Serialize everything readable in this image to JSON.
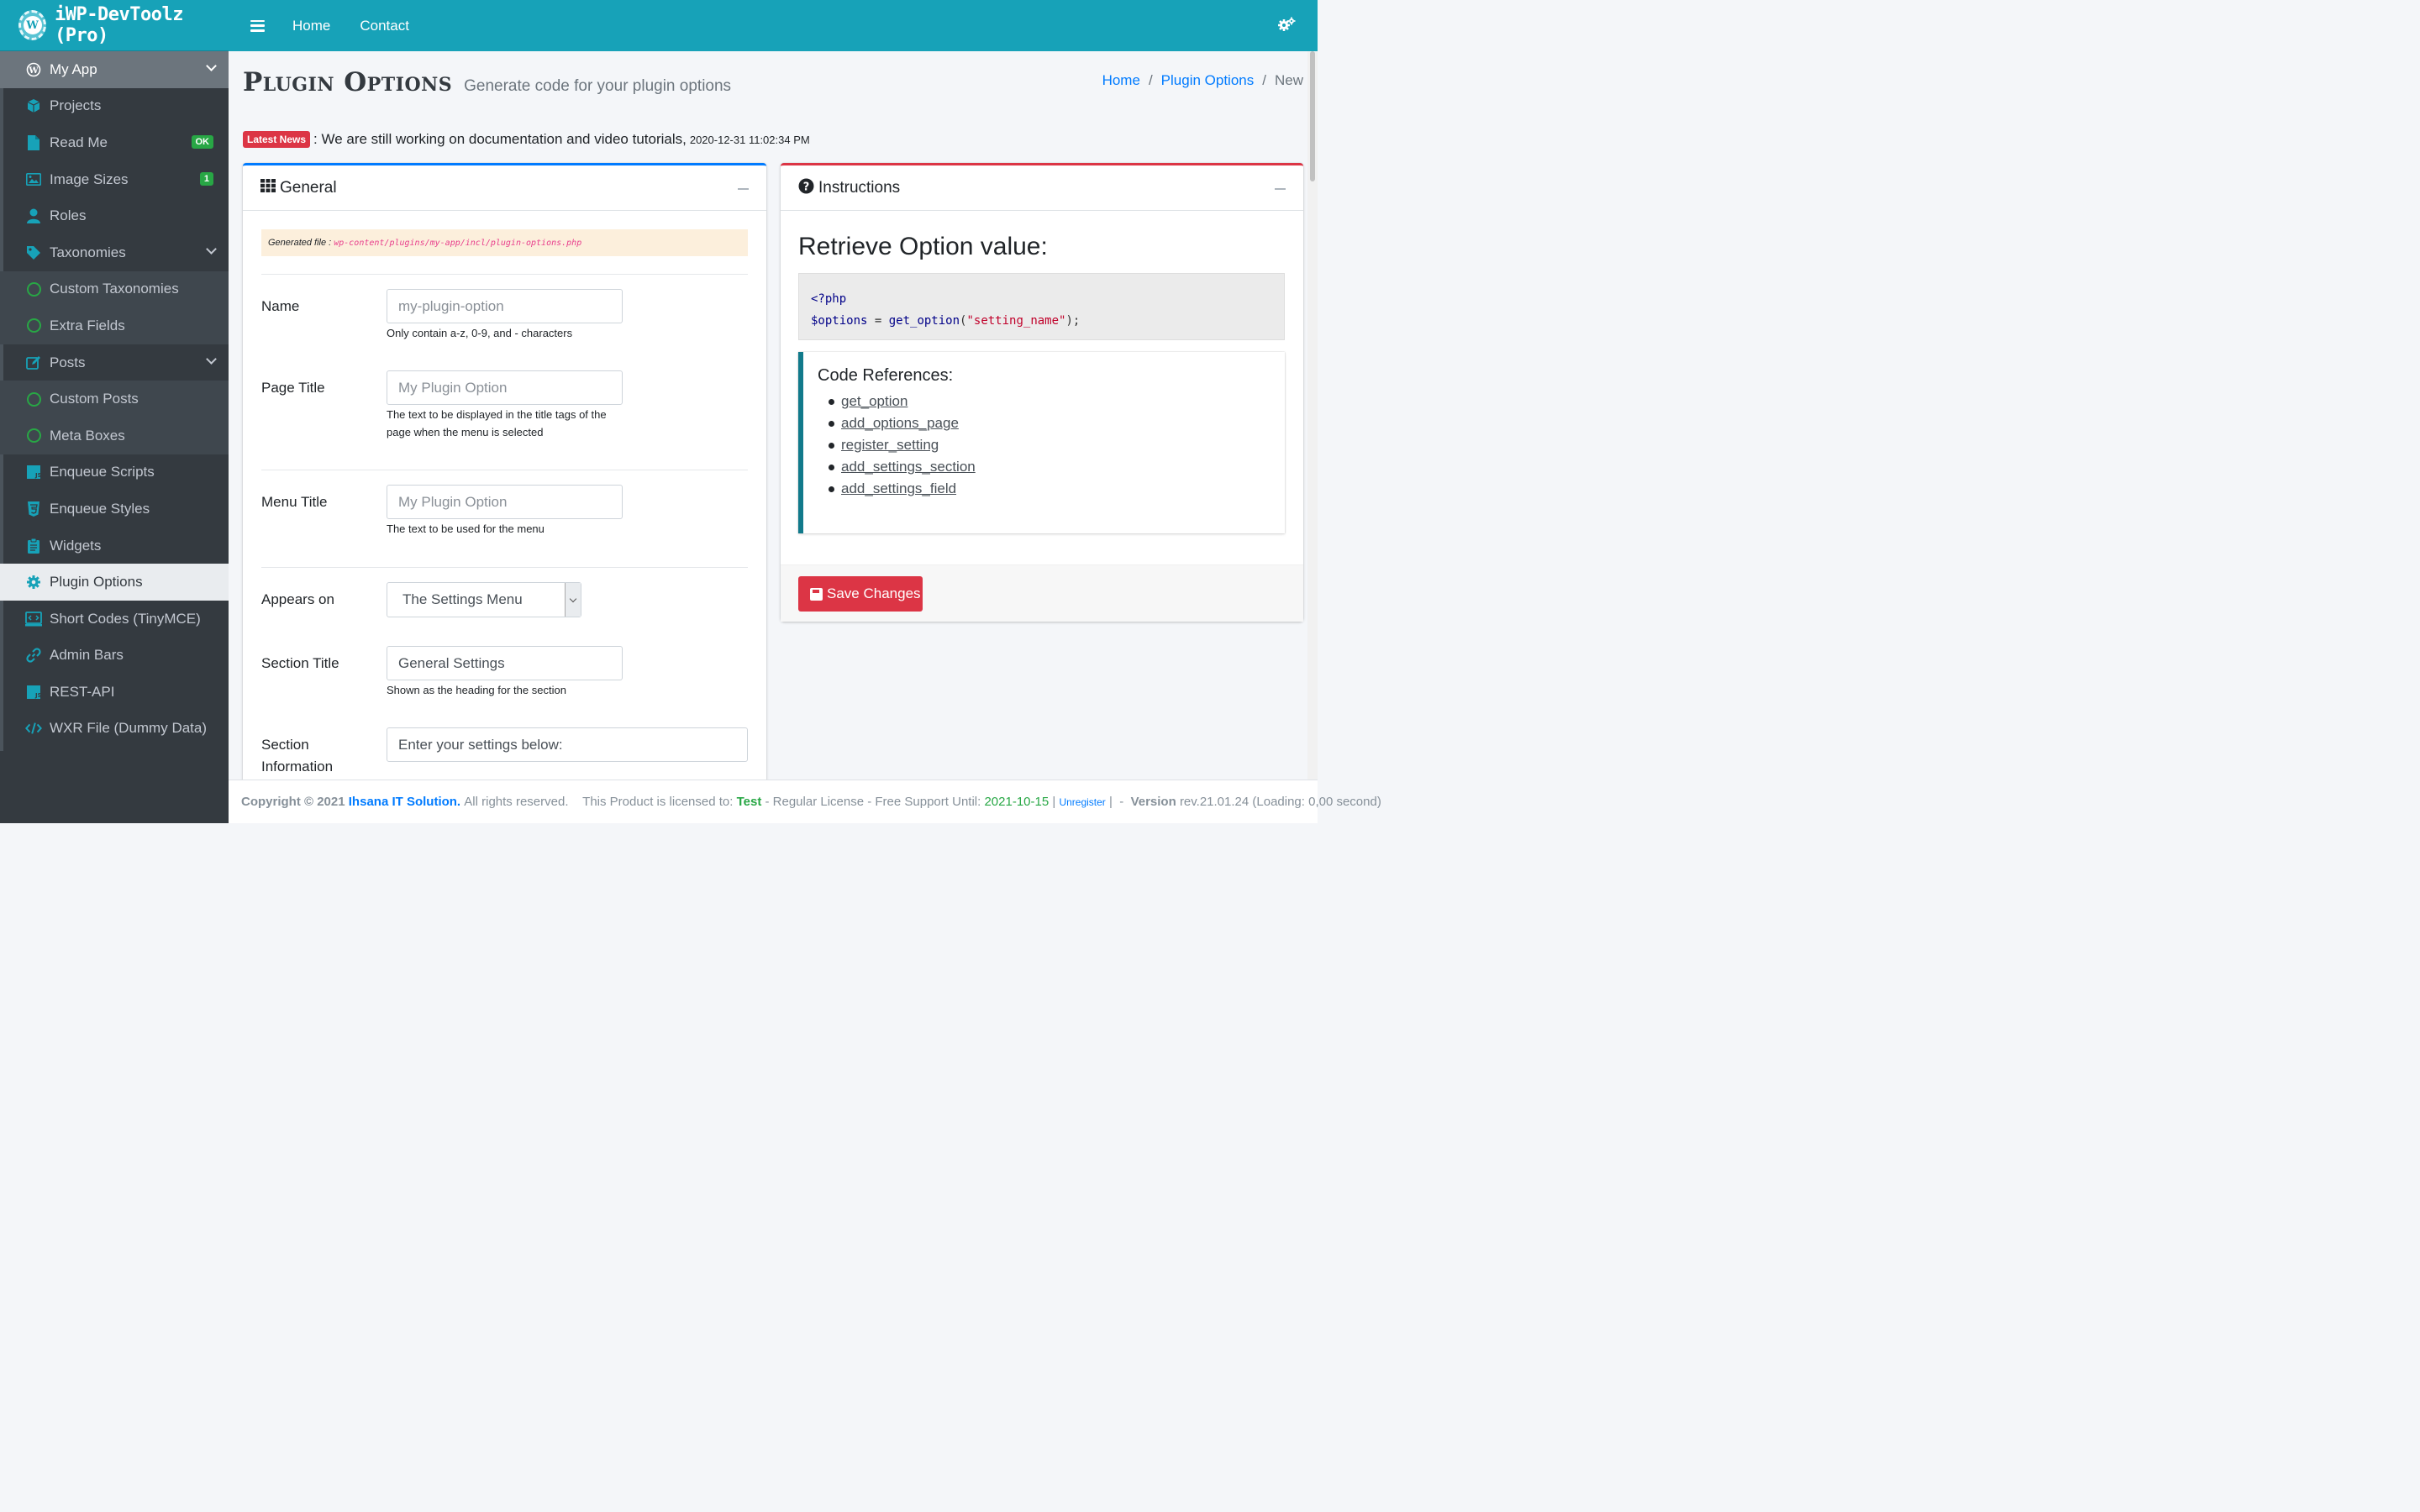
{
  "brand": {
    "title": "iWP-DevToolz (Pro)",
    "logo_letter": "W"
  },
  "topnav": {
    "links": [
      "Home",
      "Contact"
    ]
  },
  "sidebar": {
    "items": [
      {
        "label": "My App",
        "icon": "wordpress-icon"
      },
      {
        "label": "Projects",
        "icon": "cube-icon"
      },
      {
        "label": "Read Me",
        "icon": "file-icon",
        "badge": "OK"
      },
      {
        "label": "Image Sizes",
        "icon": "image-icon",
        "badge": "1"
      },
      {
        "label": "Roles",
        "icon": "user-icon"
      },
      {
        "label": "Taxonomies",
        "icon": "tag-icon"
      },
      {
        "label": "Custom Taxonomies",
        "icon": "circle-icon"
      },
      {
        "label": "Extra Fields",
        "icon": "circle-icon"
      },
      {
        "label": "Posts",
        "icon": "edit-icon"
      },
      {
        "label": "Custom Posts",
        "icon": "circle-icon"
      },
      {
        "label": "Meta Boxes",
        "icon": "circle-icon"
      },
      {
        "label": "Enqueue Scripts",
        "icon": "js-icon"
      },
      {
        "label": "Enqueue Styles",
        "icon": "css-icon"
      },
      {
        "label": "Widgets",
        "icon": "clipboard-icon"
      },
      {
        "label": "Plugin Options",
        "icon": "gear-icon"
      },
      {
        "label": "Short Codes (TinyMCE)",
        "icon": "code-window-icon"
      },
      {
        "label": "Admin Bars",
        "icon": "link-icon"
      },
      {
        "label": "REST-API",
        "icon": "js-icon"
      },
      {
        "label": "WXR File (Dummy Data)",
        "icon": "code-icon"
      }
    ]
  },
  "page": {
    "title": "Plugin Options",
    "subtitle": "Generate code for your plugin options",
    "breadcrumb": [
      "Home",
      "Plugin Options",
      "New"
    ]
  },
  "news": {
    "label": "Latest News",
    "text": ": We are still working on documentation and video tutorials,",
    "time": "2020-12-31 11:02:34 PM"
  },
  "general": {
    "header": "General",
    "generated_label": "Generated file :",
    "generated_path": "wp-content/plugins/my-app/incl/plugin-options.php",
    "fields": {
      "name": {
        "label": "Name",
        "placeholder": "my-plugin-option",
        "help": "Only contain a-z, 0-9, and - characters"
      },
      "page_title": {
        "label": "Page Title",
        "placeholder": "My Plugin Option",
        "help1": "The text to be displayed in the title tags of the",
        "help2": "page when the menu is selected"
      },
      "menu_title": {
        "label": "Menu Title",
        "placeholder": "My Plugin Option",
        "help": "The text to be used for the menu"
      },
      "appears_on": {
        "label": "Appears on",
        "value": "The Settings Menu"
      },
      "section_title": {
        "label": "Section Title",
        "value": "General Settings",
        "help": "Shown as the heading for the section"
      },
      "section_info": {
        "label1": "Section",
        "label2": "Information",
        "value": "Enter your settings below:"
      }
    }
  },
  "instructions": {
    "header": "Instructions",
    "heading": "Retrieve Option value:",
    "code": {
      "line1": "<?php",
      "var": "$options",
      "eq": " = ",
      "fn": "get_option",
      "open": "(",
      "arg": "\"setting_name\"",
      "close": ");"
    },
    "refs_title": "Code References:",
    "refs": [
      "get_option",
      "add_options_page",
      "register_setting",
      "add_settings_section",
      "add_settings_field"
    ],
    "save": "Save Changes"
  },
  "footer": {
    "copy": "Copyright © 2021",
    "company": "Ihsana IT Solution.",
    "rights": "All rights reserved.",
    "licensed": "This Product is licensed to:",
    "licensee": "Test",
    "license_type": "- Regular License - Free Support Until:",
    "support_until": "2021-10-15",
    "pipe1": "|",
    "unregister": "Unregister",
    "pipe2": "|",
    "dash": "-",
    "version_label": "Version",
    "version": "rev.21.01.24 (Loading: 0,00 second)"
  },
  "colors": {
    "accent": "#17a2b8",
    "sidebar": "#343a40",
    "primary": "#007bff",
    "danger": "#dc3545",
    "success": "#28a745"
  }
}
